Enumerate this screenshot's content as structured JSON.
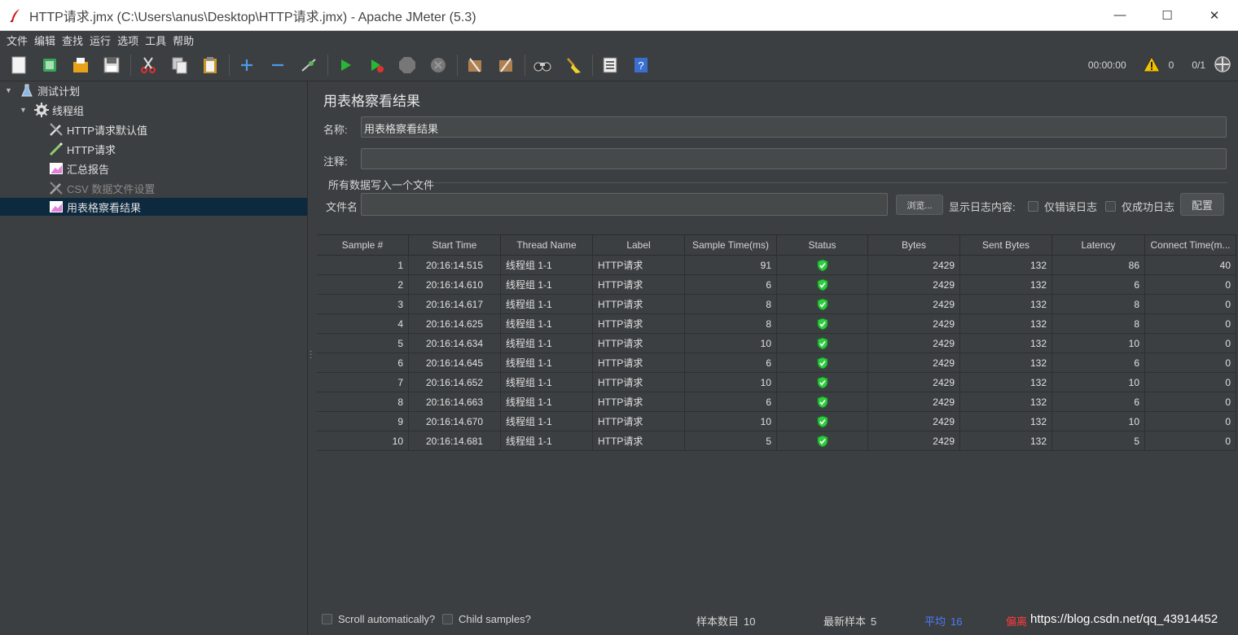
{
  "window": {
    "title": "HTTP请求.jmx (C:\\Users\\anus\\Desktop\\HTTP请求.jmx) - Apache JMeter (5.3)"
  },
  "menu": [
    "文件",
    "编辑",
    "查找",
    "运行",
    "选项",
    "工具",
    "帮助"
  ],
  "toolbar": {
    "timer": "00:00:00",
    "warnings": "0",
    "threads": "0/1"
  },
  "tree": {
    "items": [
      {
        "label": "测试计划",
        "icon": "flask-icon"
      },
      {
        "label": "线程组",
        "icon": "gear-icon"
      },
      {
        "label": "HTTP请求默认值",
        "icon": "wrench-icon"
      },
      {
        "label": "HTTP请求",
        "icon": "pen-icon"
      },
      {
        "label": "汇总报告",
        "icon": "chart-icon"
      },
      {
        "label": "CSV 数据文件设置",
        "icon": "wrench-icon"
      },
      {
        "label": "用表格察看结果",
        "icon": "chart-icon"
      }
    ]
  },
  "panel": {
    "title": "用表格察看结果",
    "name_label": "名称:",
    "name_value": "用表格察看结果",
    "comment_label": "注释:",
    "comment_value": "",
    "group_title": "所有数据写入一个文件",
    "filename_label": "文件名",
    "filename_value": "",
    "browse_button": "浏览...",
    "log_label": "显示日志内容:",
    "errors_only": "仅错误日志",
    "success_only": "仅成功日志",
    "configure_button": "配置"
  },
  "table": {
    "headers": [
      "Sample #",
      "Start Time",
      "Thread Name",
      "Label",
      "Sample Time(ms)",
      "Status",
      "Bytes",
      "Sent Bytes",
      "Latency",
      "Connect Time(m..."
    ],
    "rows": [
      [
        "1",
        "20:16:14.515",
        "线程组 1-1",
        "HTTP请求",
        "91",
        "ok",
        "2429",
        "132",
        "86",
        "40"
      ],
      [
        "2",
        "20:16:14.610",
        "线程组 1-1",
        "HTTP请求",
        "6",
        "ok",
        "2429",
        "132",
        "6",
        "0"
      ],
      [
        "3",
        "20:16:14.617",
        "线程组 1-1",
        "HTTP请求",
        "8",
        "ok",
        "2429",
        "132",
        "8",
        "0"
      ],
      [
        "4",
        "20:16:14.625",
        "线程组 1-1",
        "HTTP请求",
        "8",
        "ok",
        "2429",
        "132",
        "8",
        "0"
      ],
      [
        "5",
        "20:16:14.634",
        "线程组 1-1",
        "HTTP请求",
        "10",
        "ok",
        "2429",
        "132",
        "10",
        "0"
      ],
      [
        "6",
        "20:16:14.645",
        "线程组 1-1",
        "HTTP请求",
        "6",
        "ok",
        "2429",
        "132",
        "6",
        "0"
      ],
      [
        "7",
        "20:16:14.652",
        "线程组 1-1",
        "HTTP请求",
        "10",
        "ok",
        "2429",
        "132",
        "10",
        "0"
      ],
      [
        "8",
        "20:16:14.663",
        "线程组 1-1",
        "HTTP请求",
        "6",
        "ok",
        "2429",
        "132",
        "6",
        "0"
      ],
      [
        "9",
        "20:16:14.670",
        "线程组 1-1",
        "HTTP请求",
        "10",
        "ok",
        "2429",
        "132",
        "10",
        "0"
      ],
      [
        "10",
        "20:16:14.681",
        "线程组 1-1",
        "HTTP请求",
        "5",
        "ok",
        "2429",
        "132",
        "5",
        "0"
      ]
    ]
  },
  "bottom": {
    "scroll_auto": "Scroll automatically?",
    "child_samples": "Child samples?",
    "sample_count_label": "样本数目",
    "sample_count": "10",
    "latest_sample_label": "最新样本",
    "latest_sample": "5",
    "average_label": "平均",
    "average": "16",
    "deviation_label": "偏离",
    "watermark": "https://blog.csdn.net/qq_43914452"
  },
  "colors": {
    "background": "#3c3f41",
    "selected": "#0d293e",
    "status_ok": "#2ecc40",
    "average": "#4a7dff",
    "deviation": "#ff3b3b"
  }
}
